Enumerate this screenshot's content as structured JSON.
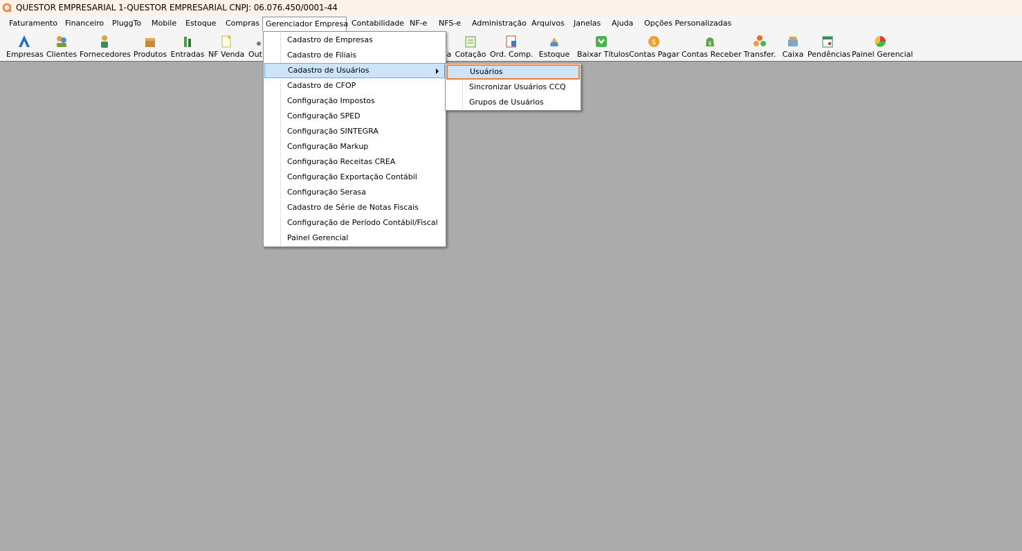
{
  "window": {
    "title": "QUESTOR EMPRESARIAL 1-QUESTOR EMPRESARIAL CNPJ: 06.076.450/0001-44",
    "logo_icon": "questor-logo-icon",
    "accent_color": "#f07f3c"
  },
  "menubar": {
    "items": [
      {
        "label": "Faturamento"
      },
      {
        "label": "Financeiro"
      },
      {
        "label": "PluggTo"
      },
      {
        "label": "Mobile"
      },
      {
        "label": "Estoque"
      },
      {
        "label": "Compras"
      },
      {
        "label": "Gerenciador Empresa"
      },
      {
        "label": "Contabilidade"
      },
      {
        "label": "NF-e"
      },
      {
        "label": "NFS-e"
      },
      {
        "label": "Administração"
      },
      {
        "label": "Arquivos"
      },
      {
        "label": "Janelas"
      },
      {
        "label": "Ajuda"
      },
      {
        "label": "Opções Personalizadas"
      }
    ],
    "active": "Gerenciador Empresa"
  },
  "toolbar": {
    "buttons": [
      {
        "label": "Empresas",
        "icon": "empresas-icon"
      },
      {
        "label": "Clientes",
        "icon": "clientes-icon"
      },
      {
        "label": "Fornecedores",
        "icon": "fornecedores-icon"
      },
      {
        "label": "Produtos",
        "icon": "produtos-icon"
      },
      {
        "label": "Entradas",
        "icon": "entradas-icon"
      },
      {
        "label": "NF Venda",
        "icon": "nf-venda-icon"
      },
      {
        "label": "Out",
        "icon": "outros-icon"
      },
      {
        "label": "a",
        "icon": "hidden-icon"
      },
      {
        "label": "Cotação",
        "icon": "cotacao-icon"
      },
      {
        "label": "Ord. Comp.",
        "icon": "ordem-compra-icon"
      },
      {
        "label": "Estoque",
        "icon": "estoque-icon"
      },
      {
        "label": "Baixar Títulos",
        "icon": "baixar-titulos-icon"
      },
      {
        "label": "Contas Pagar",
        "icon": "contas-pagar-icon"
      },
      {
        "label": "Contas Receber",
        "icon": "contas-receber-icon"
      },
      {
        "label": "Transfer.",
        "icon": "transfer-icon"
      },
      {
        "label": "Caixa",
        "icon": "caixa-icon"
      },
      {
        "label": "Pendências",
        "icon": "pendencias-icon"
      },
      {
        "label": "Painel Gerencial",
        "icon": "painel-gerencial-icon"
      }
    ]
  },
  "dropdown": {
    "items": [
      {
        "label": "Cadastro de Empresas"
      },
      {
        "label": "Cadastro de Filiais"
      },
      {
        "label": "Cadastro de Usuários"
      },
      {
        "label": "Cadastro de CFOP"
      },
      {
        "label": "Configuração Impostos"
      },
      {
        "label": "Configuração SPED"
      },
      {
        "label": "Configuração SINTEGRA"
      },
      {
        "label": "Configuração Markup"
      },
      {
        "label": "Configuração Receitas CREA"
      },
      {
        "label": "Configuração Exportação Contábil"
      },
      {
        "label": "Configuração Serasa"
      },
      {
        "label": "Cadastro de Série de Notas Fiscais"
      },
      {
        "label": "Configuração de Período Contábil/Fiscal"
      },
      {
        "label": "Painel Gerencial"
      }
    ],
    "highlighted": "Cadastro de Usuários"
  },
  "submenu": {
    "items": [
      {
        "label": "Usuários"
      },
      {
        "label": "Sincronizar Usuários CCQ"
      },
      {
        "label": "Grupos de Usuários"
      }
    ],
    "selected": "Usuários"
  }
}
